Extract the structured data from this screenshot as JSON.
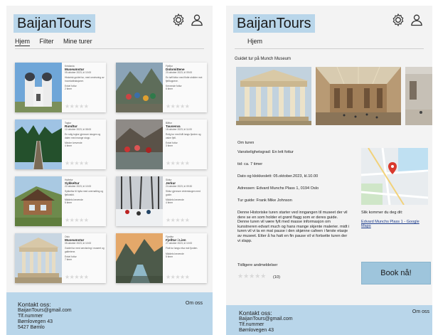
{
  "brand": "BaijanTours",
  "icons": {
    "settings": "gear-icon",
    "user": "user-icon"
  },
  "screen1": {
    "nav": [
      "Hjem",
      "Filter",
      "Mine turer"
    ],
    "cards": [
      {
        "title": "Museumstur",
        "category": "Kristiania",
        "date": "05.oktober 2023, kl 10:00",
        "desc": "Historisk guidet tur, med omvisning av hovedattraksjoner.",
        "level": "Enkel fottur",
        "duration": "2 timer"
      },
      {
        "title": "Dolomittene",
        "category": "Fjelltur",
        "date": "20.oktober 2023, kl 09:00",
        "desc": "En tøff fottur med flotte utsikter mot fjelltoppene.",
        "level": "Krevende fottur",
        "duration": "6 timer"
      },
      {
        "title": "Rundtur",
        "category": "Togtur",
        "date": "12.oktober 2023, kl 08:00",
        "desc": "En rolig togtur gjennom skogen og dalen med mange stopp.",
        "level": "Mindre krevende",
        "duration": "4 timer"
      },
      {
        "title": "Tausesva",
        "category": "Båttur",
        "date": "18.oktober 2023, kl 11:00",
        "desc": "Rolig tur med båt langs fjorden og vakre fjell.",
        "level": "Enkel fottur",
        "duration": "3 timer"
      },
      {
        "title": "Sykkeltur",
        "category": "Hyttetur",
        "date": "22.oktober 2023, kl 10:00",
        "desc": "Sykkeltur til hytta med overnatting og fjellutsikt.",
        "level": "Middels krevende",
        "duration": "5 timer"
      },
      {
        "title": "Jerkur",
        "category": "Skitur",
        "date": "24.oktober 2023, kl 09:30",
        "desc": "Skitur gjennom vinterskogen med guide.",
        "level": "Middels krevende",
        "duration": "4 timer"
      },
      {
        "title": "Museumstur",
        "category": "Oslo",
        "date": "05.oktober 2023, kl 10:00",
        "desc": "Guidet tur med omvisning i museet og galleriene.",
        "level": "Enkel fottur",
        "duration": "7 timer"
      },
      {
        "title": "Fjelltur i Lien",
        "category": "Fjordtur",
        "date": "27.oktober 2023, kl 10:00",
        "desc": "Flott tur langs elva mot fjorden.",
        "level": "Middels krevende",
        "duration": "5 timer"
      }
    ]
  },
  "screen2": {
    "nav": [
      "Hjem"
    ],
    "subtitle": "Guidet tur på Munch Museum",
    "info": {
      "header": "Om turen",
      "difficulty": "Vanskelighetsgrad: En lett fottur",
      "time": "tid: ca. 7 timer",
      "datetime": "Dato og klokkeslett: 05.oktober.2023, kl.10.00",
      "address": "Adressen: Edvard Munchs Plass 1, 0194 Oslo",
      "guide": "Tur guide: Frank Mike Johnson"
    },
    "description": "Denne Historiske turen starter ved inngangen til museet der vil dere se en som holder et grønt flagg som er deres guide. Denne turen vil være fylt med masse informasjon om kunstneren edvart much og hans mange skjente malerier. midt i turen vil vi ta en mat pause i den skjønne cafeen i første etasje av museet. Etter å ha hatt en fin pause vil vi fortsette turen der vi slapp.",
    "reviews_label": "Tidligere andmeldelser",
    "reviews_count": "(10)",
    "directions_label": "Slik kommer du deg dit:",
    "directions_link": "Edvard Munchs Plass 1 - Google Maps",
    "book_button": "Book nå!"
  },
  "footer": {
    "heading": "Kontakt oss:",
    "email": "BaijanTours@gmail.com",
    "phone": "Tlf.nummer",
    "street": "Bømlovegen 43",
    "city": "5427 Bømlo",
    "about": "Om oss"
  },
  "stars_empty": "★★★★★"
}
